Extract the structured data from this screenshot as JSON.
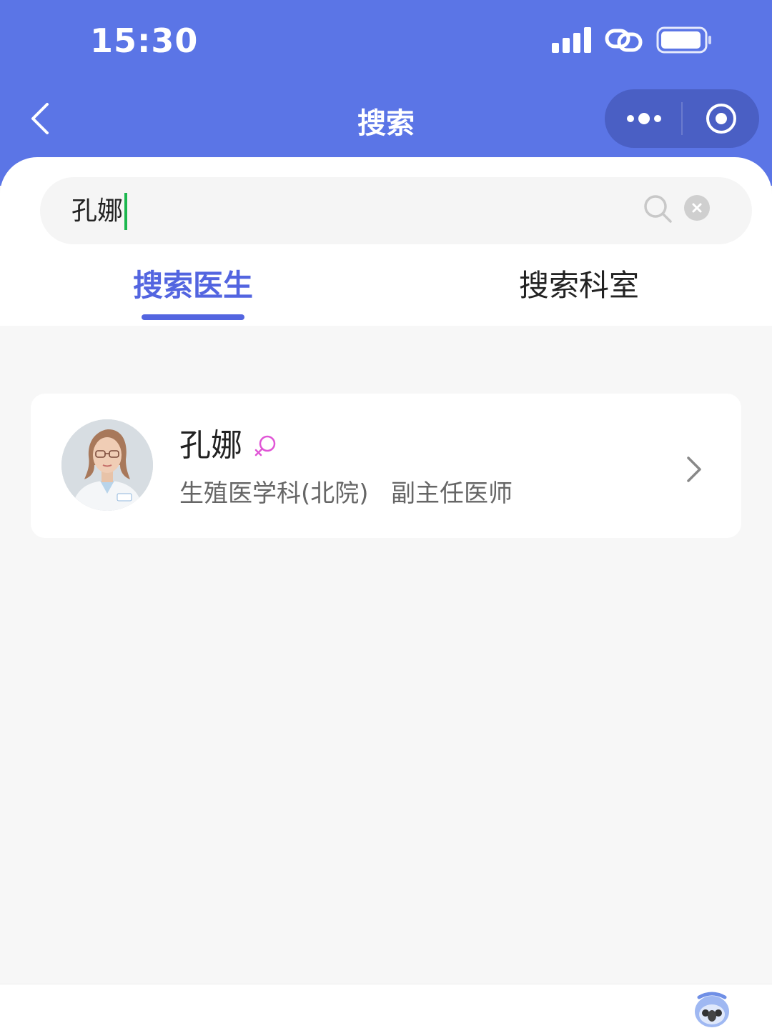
{
  "status_bar": {
    "time": "15:30"
  },
  "nav": {
    "title": "搜索"
  },
  "search": {
    "query": "孔娜"
  },
  "tabs": [
    {
      "label": "搜索医生",
      "active": true
    },
    {
      "label": "搜索科室",
      "active": false
    }
  ],
  "results": [
    {
      "name": "孔娜",
      "gender": "female",
      "department": "生殖医学科(北院)",
      "title": "副主任医师"
    }
  ],
  "colors": {
    "header": "#5b75e6",
    "accent": "#5365e0",
    "female_icon": "#e055d6"
  }
}
